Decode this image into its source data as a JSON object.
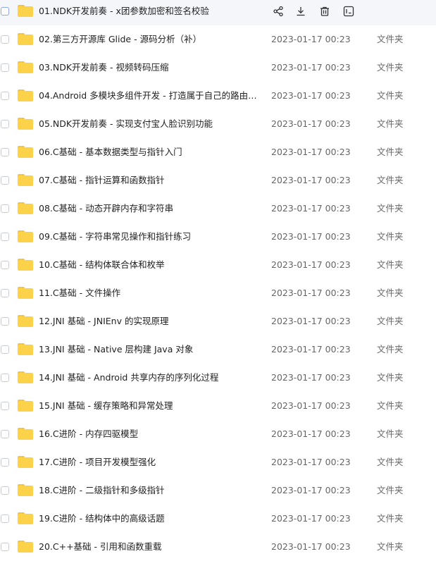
{
  "hover_actions": {
    "icons": [
      "share-icon",
      "download-icon",
      "delete-icon",
      "rename-icon"
    ]
  },
  "files": [
    {
      "name": "01.NDK开发前奏 - x团参数加密和签名校验",
      "date": "",
      "type": ""
    },
    {
      "name": "02.第三方开源库 Glide - 源码分析（补）",
      "date": "2023-01-17 00:23",
      "type": "文件夹"
    },
    {
      "name": "03.NDK开发前奏 - 视频转码压缩",
      "date": "2023-01-17 00:23",
      "type": "文件夹"
    },
    {
      "name": "04.Android 多模块多组件开发 - 打造属于自己的路由（...",
      "date": "2023-01-17 00:23",
      "type": "文件夹"
    },
    {
      "name": "05.NDK开发前奏 - 实现支付宝人脸识别功能",
      "date": "2023-01-17 00:23",
      "type": "文件夹"
    },
    {
      "name": "06.C基础 - 基本数据类型与指针入门",
      "date": "2023-01-17 00:23",
      "type": "文件夹"
    },
    {
      "name": "07.C基础 - 指针运算和函数指针",
      "date": "2023-01-17 00:23",
      "type": "文件夹"
    },
    {
      "name": "08.C基础 - 动态开辟内存和字符串",
      "date": "2023-01-17 00:23",
      "type": "文件夹"
    },
    {
      "name": "09.C基础 - 字符串常见操作和指针练习",
      "date": "2023-01-17 00:23",
      "type": "文件夹"
    },
    {
      "name": "10.C基础 - 结构体联合体和枚举",
      "date": "2023-01-17 00:23",
      "type": "文件夹"
    },
    {
      "name": "11.C基础 - 文件操作",
      "date": "2023-01-17 00:23",
      "type": "文件夹"
    },
    {
      "name": "12.JNI 基础 - JNIEnv 的实现原理",
      "date": "2023-01-17 00:23",
      "type": "文件夹"
    },
    {
      "name": "13.JNI 基础 - Native 层构建 Java 对象",
      "date": "2023-01-17 00:23",
      "type": "文件夹"
    },
    {
      "name": "14.JNI 基础 - Android 共享内存的序列化过程",
      "date": "2023-01-17 00:23",
      "type": "文件夹"
    },
    {
      "name": "15.JNI 基础 - 缓存策略和异常处理",
      "date": "2023-01-17 00:23",
      "type": "文件夹"
    },
    {
      "name": "16.C进阶 - 内存四驱模型",
      "date": "2023-01-17 00:23",
      "type": "文件夹"
    },
    {
      "name": "17.C进阶 - 项目开发模型强化",
      "date": "2023-01-17 00:23",
      "type": "文件夹"
    },
    {
      "name": "18.C进阶 - 二级指针和多级指针",
      "date": "2023-01-17 00:23",
      "type": "文件夹"
    },
    {
      "name": "19.C进阶 - 结构体中的高级话题",
      "date": "2023-01-17 00:23",
      "type": "文件夹"
    },
    {
      "name": "20.C++基础 - 引用和函数重载",
      "date": "2023-01-17 00:23",
      "type": "文件夹"
    }
  ]
}
